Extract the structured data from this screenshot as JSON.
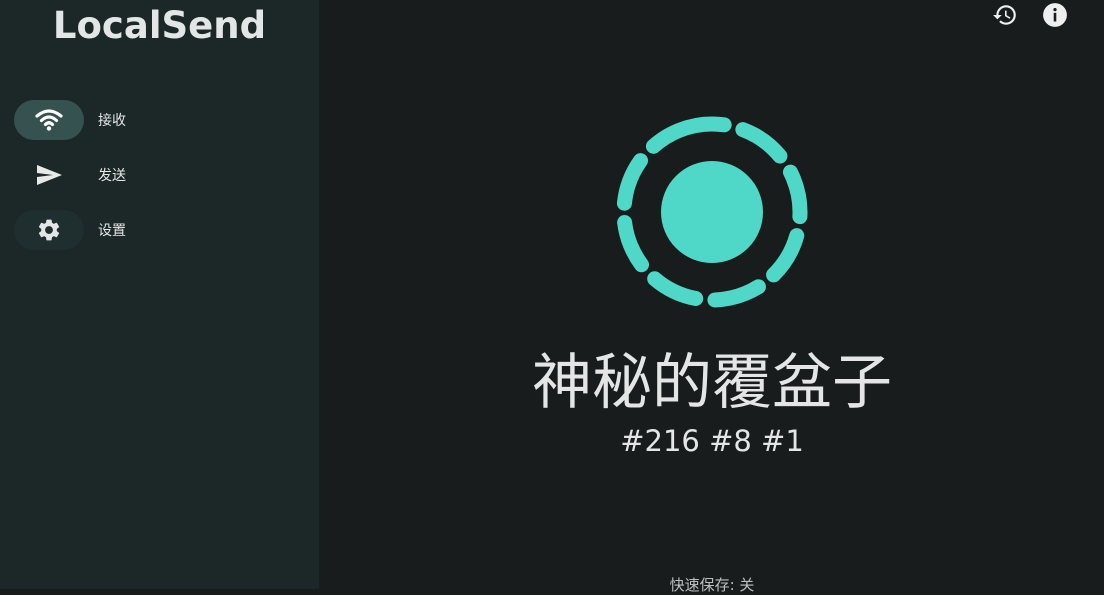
{
  "app": {
    "title": "LocalSend"
  },
  "sidebar": {
    "items": [
      {
        "label": "接收",
        "icon": "wifi-icon",
        "active": true
      },
      {
        "label": "发送",
        "icon": "send-icon",
        "active": false
      },
      {
        "label": "设置",
        "icon": "gear-icon",
        "active": false
      }
    ]
  },
  "toolbar": {
    "history_icon": "history-icon",
    "info_icon": "info-icon"
  },
  "main": {
    "device_name": "神秘的覆盆子",
    "device_tags": "#216 #8 #1",
    "quick_save": "快速保存: 关"
  },
  "colors": {
    "accent": "#4fd8c8",
    "background": "#191c1c",
    "sidebar": "#1c2727",
    "active_pill": "#355251"
  }
}
